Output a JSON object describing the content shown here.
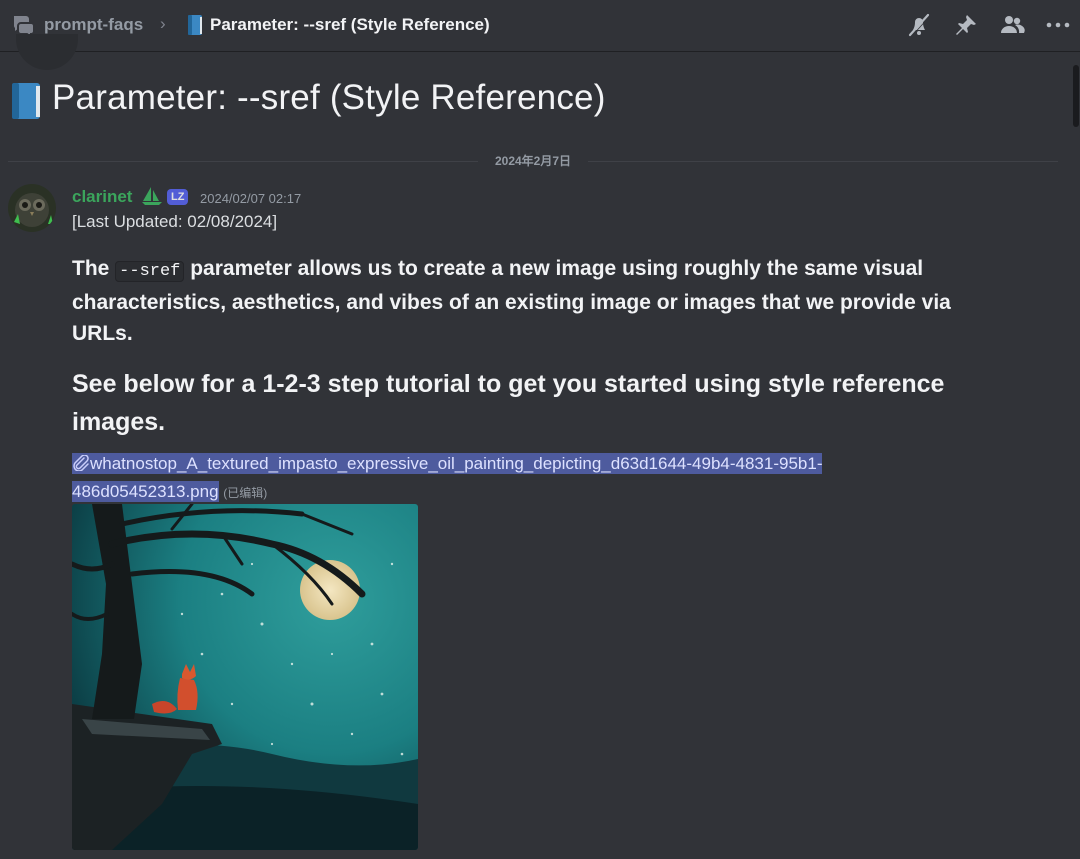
{
  "topbar": {
    "channel_name": "prompt-faqs",
    "separator": "›",
    "thread_title": "Parameter: --sref (Style Reference)",
    "actions": [
      "bell-off-icon",
      "pin-icon",
      "members-icon",
      "more-icon"
    ]
  },
  "thread": {
    "title": "Parameter: --sref (Style Reference)",
    "title_emoji": "blue-book-icon"
  },
  "date_divider": "2024年2月7日",
  "message": {
    "author": "clarinet",
    "author_color": "#3ba55c",
    "role_badge": "LZ",
    "timestamp": "2024/02/07 02:17",
    "last_updated": "[Last Updated: 02/08/2024]",
    "para_before": "The ",
    "para_code": "--sref",
    "para_after": " parameter allows us to create a new image using roughly the same visual characteristics, aesthetics, and vibes of an existing image or images that we provide via URLs.",
    "subheading": "See below for a 1-2-3 step tutorial to get you started using style reference images.",
    "attachment_name": "whatnostop_A_textured_impasto_expressive_oil_painting_depicting_d63d1644-49b4-4831-95b1-486d05452313.png",
    "attachment_edited": "(已编辑)"
  },
  "colors": {
    "background": "#313338",
    "link_highlight": "#4e5b9e",
    "badge": "#5865f2"
  }
}
